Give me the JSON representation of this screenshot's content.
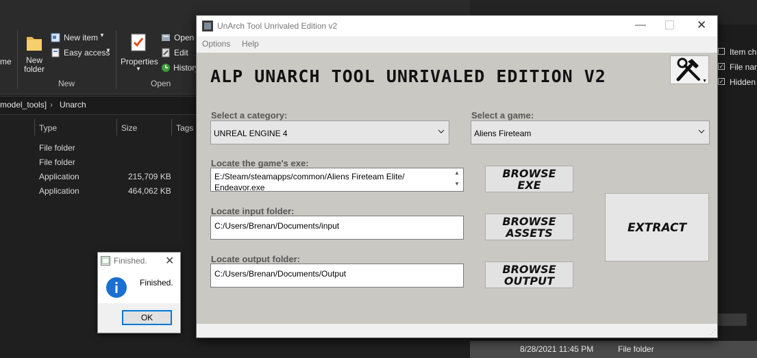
{
  "explorer": {
    "ribbon": {
      "partial_left_label": "me",
      "new_folder": "New\nfolder",
      "new_item": "New item",
      "easy_access": "Easy access",
      "group_new": "New",
      "properties": "Properties",
      "open": "Open",
      "edit": "Edit",
      "history": "History",
      "group_open": "Open",
      "item_checkboxes": "Item che",
      "file_name_ext": "File nam",
      "hidden_items": "Hidden"
    },
    "address": {
      "segment1": "model_tools]",
      "segment2": "Unarch"
    },
    "columns": {
      "type": "Type",
      "size": "Size",
      "tags": "Tags"
    },
    "rows": [
      {
        "type": "File folder",
        "size": ""
      },
      {
        "type": "File folder",
        "size": ""
      },
      {
        "type": "Application",
        "size": "215,709 KB"
      },
      {
        "type": "Application",
        "size": "464,062 KB"
      }
    ],
    "status_row": {
      "date": "8/28/2021 11:45 PM",
      "type": "File folder"
    }
  },
  "finished_dialog": {
    "title": "Finished.",
    "message": "Finished.",
    "ok": "OK"
  },
  "app": {
    "window_title": "UnArch Tool Unrivaled Edition v2",
    "menu": [
      "Options",
      "Help"
    ],
    "heading": "ALP UNARCH TOOL UNRIVALED EDITION V2",
    "category_label": "Select a category:",
    "category_value": "UNREAL ENGINE 4",
    "game_label": "Select a game:",
    "game_value": "Aliens Fireteam",
    "exe_label": "Locate the game's exe:",
    "exe_value": "E:/Steam/steamapps/common/Aliens Fireteam Elite/\nEndeavor.exe",
    "input_label": "Locate input folder:",
    "input_value": "C:/Users/Brenan/Documents/input",
    "output_label": "Locate output folder:",
    "output_value": "C:/Users/Brenan/Documents/Output",
    "browse_exe": [
      "BROWSE",
      "EXE"
    ],
    "browse_assets": [
      "BROWSE",
      "ASSETS"
    ],
    "browse_output": [
      "BROWSE",
      "OUTPUT"
    ],
    "extract": "EXTRACT"
  },
  "colors": {
    "client_bg": "#c9c8c3",
    "explorer_bg": "#1f1f1f",
    "info_blue": "#1a6fd1"
  },
  "icons": [
    "folder-icon",
    "new-item-icon",
    "easy-access-icon",
    "properties-icon",
    "open-icon",
    "edit-icon",
    "history-icon",
    "info-icon",
    "app-icon",
    "tools-icon",
    "minimize-icon",
    "maximize-icon",
    "close-icon",
    "chevron-down-icon"
  ]
}
